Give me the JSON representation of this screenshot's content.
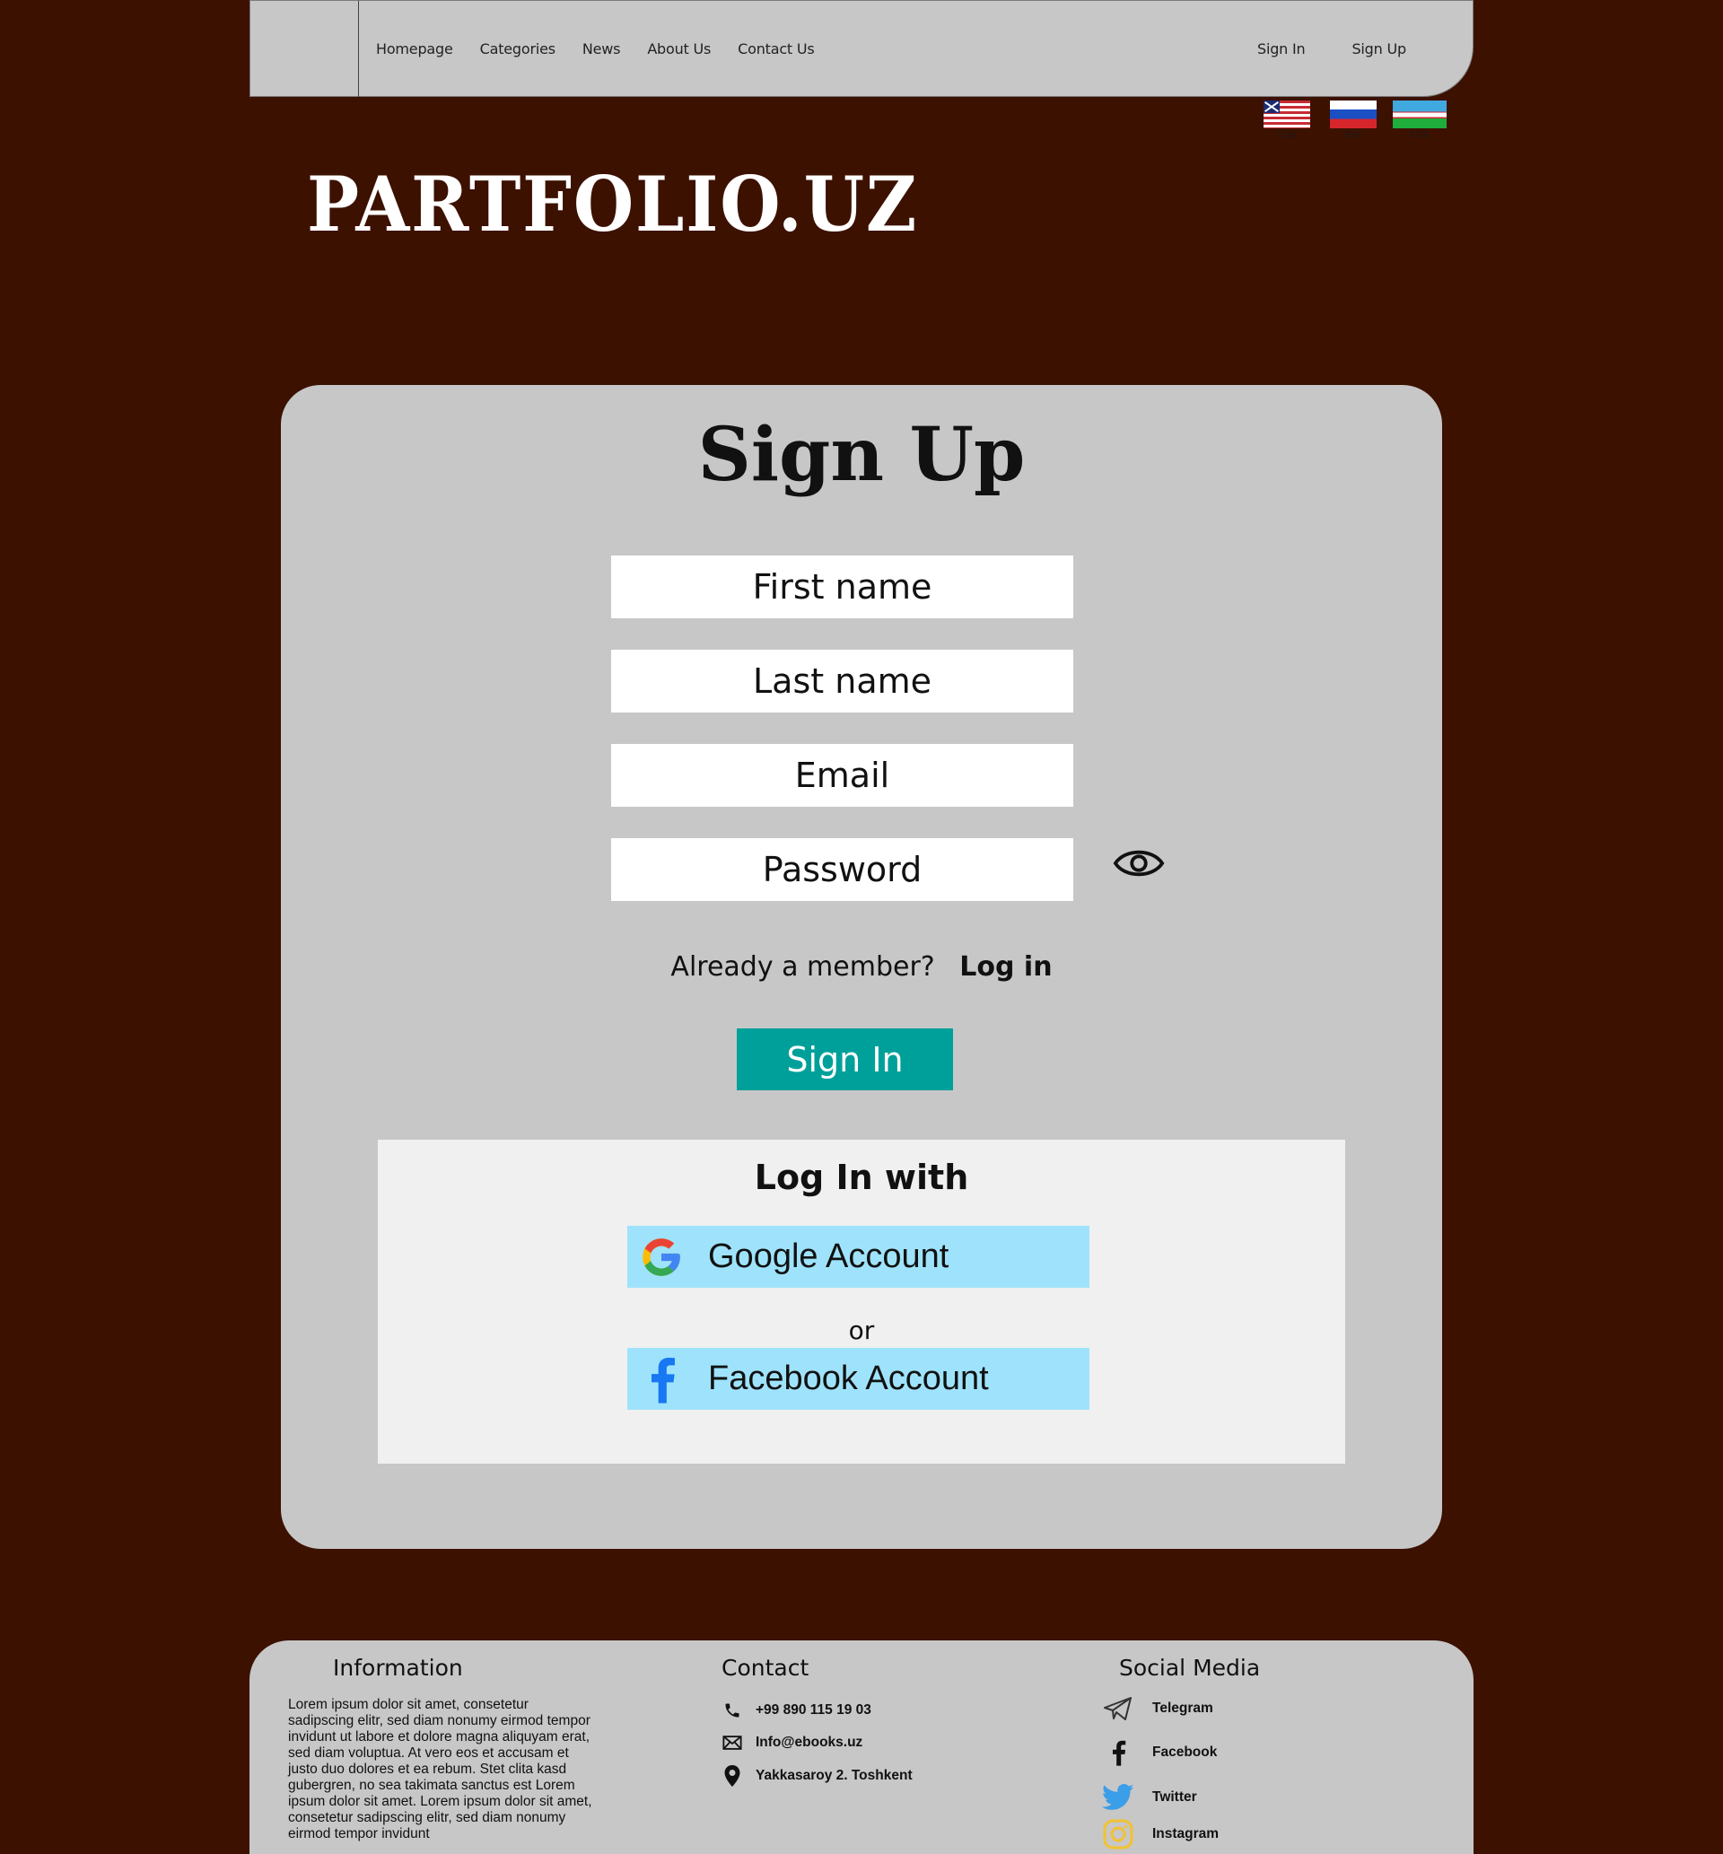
{
  "nav": {
    "items": [
      "Homepage",
      "Categories",
      "News",
      "About Us",
      "Contact Us"
    ],
    "sign_in": "Sign In",
    "sign_up": "Sign Up"
  },
  "languages": [
    {
      "label": "Eng",
      "icon": "us-flag-icon"
    },
    {
      "label": "Rus",
      "icon": "russia-flag-icon"
    },
    {
      "label": "Uzb",
      "icon": "uzbekistan-flag-icon"
    }
  ],
  "brand": "PARTFOLIO.UZ",
  "form": {
    "title": "Sign Up",
    "first_name_placeholder": "First name",
    "last_name_placeholder": "Last name",
    "email_placeholder": "Email",
    "password_placeholder": "Password",
    "member_text": "Already a member?",
    "login_link": "Log in",
    "submit": "Sign In"
  },
  "social_login": {
    "title": "Log In with",
    "google": "Google Account",
    "or": "or",
    "facebook": "Facebook Account"
  },
  "footer": {
    "info_title": "Information",
    "info_text": "Lorem ipsum dolor sit amet, consetetur sadipscing elitr, sed diam nonumy eirmod tempor invidunt ut labore et dolore magna aliquyam erat, sed diam voluptua. At vero eos et accusam et justo duo dolores et ea rebum. Stet clita kasd gubergren, no sea takimata sanctus est Lorem ipsum dolor sit amet. Lorem ipsum dolor sit amet, consetetur sadipscing elitr, sed diam nonumy eirmod tempor invidunt",
    "contact_title": "Contact",
    "phone": "+99 890 115 19 03",
    "email": "Info@ebooks.uz",
    "address": "Yakkasaroy 2. Toshkent",
    "social_title": "Social Media",
    "telegram": "Telegram",
    "facebook": "Facebook",
    "twitter": "Twitter",
    "instagram": "Instagram"
  },
  "colors": {
    "background": "#3c1100",
    "panel": "#c7c7c7",
    "accent": "#00a09a",
    "oauth_button": "#9ee3fb"
  }
}
